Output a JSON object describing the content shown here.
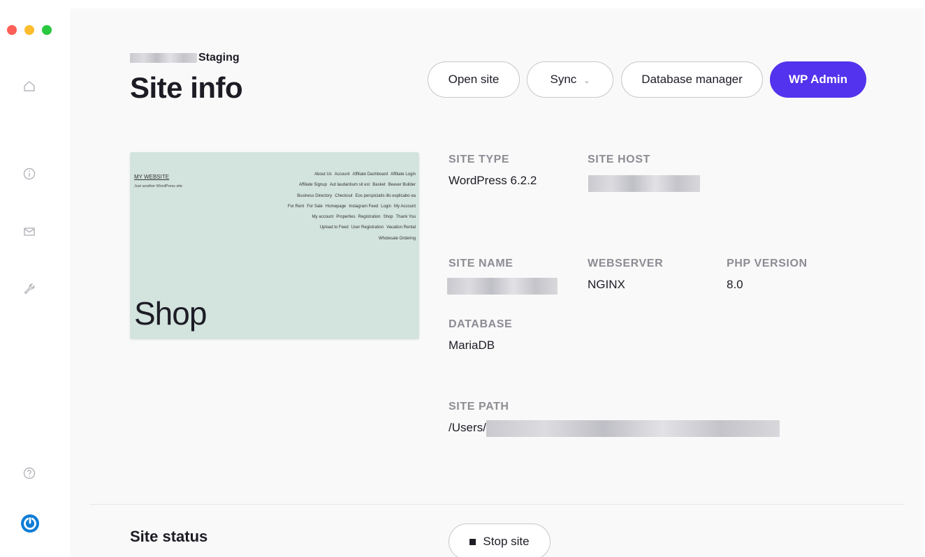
{
  "window": {
    "controls": [
      "close",
      "minimize",
      "zoom"
    ]
  },
  "sidebar": {
    "items": [
      {
        "icon": "home-icon"
      },
      {
        "icon": "info-icon"
      },
      {
        "icon": "mail-icon"
      },
      {
        "icon": "wrench-icon"
      },
      {
        "icon": "help-icon"
      },
      {
        "icon": "devkinsta-logo-icon"
      }
    ]
  },
  "header": {
    "site_env": "Staging",
    "title": "Site info"
  },
  "toolbar": {
    "open_site": "Open site",
    "sync": "Sync",
    "database_manager": "Database manager",
    "wp_admin": "WP Admin"
  },
  "colors": {
    "accent": "#5333ed",
    "preview_bg": "#d3e3dd"
  },
  "preview": {
    "site_title": "MY WEBSITE",
    "tagline": "Just another WordPress site",
    "nav_lines": [
      [
        "About Us",
        "Account",
        "Affiliate Dashboard",
        "Affiliate Login"
      ],
      [
        "Affiliate Signup",
        "Aut laudantium sit est",
        "Basket",
        "Beaver Builder"
      ],
      [
        "Business Directory",
        "Checkout",
        "Eos perspiciatis illo explicabo ea"
      ],
      [
        "For Rent",
        "For Sale",
        "Homepage",
        "Instagram Feed",
        "Login",
        "My Account"
      ],
      [
        "My account",
        "Properties",
        "Registration",
        "Shop",
        "Thank You"
      ],
      [
        "Upload to Feed",
        "User Registration",
        "Vacation Rental"
      ],
      [
        "Wholesale Ordering"
      ]
    ],
    "heading": "Shop"
  },
  "info": {
    "site_type": {
      "label": "SITE TYPE",
      "value": "WordPress 6.2.2"
    },
    "site_host": {
      "label": "SITE HOST",
      "value": ""
    },
    "site_name": {
      "label": "SITE NAME",
      "value": ""
    },
    "webserver": {
      "label": "WEBSERVER",
      "value": "NGINX"
    },
    "php_version": {
      "label": "PHP VERSION",
      "value": "8.0"
    },
    "database": {
      "label": "DATABASE",
      "value": "MariaDB"
    },
    "site_path": {
      "label": "SITE PATH",
      "value": "/Users/"
    }
  },
  "status": {
    "title": "Site status",
    "stop_site": "Stop site"
  }
}
